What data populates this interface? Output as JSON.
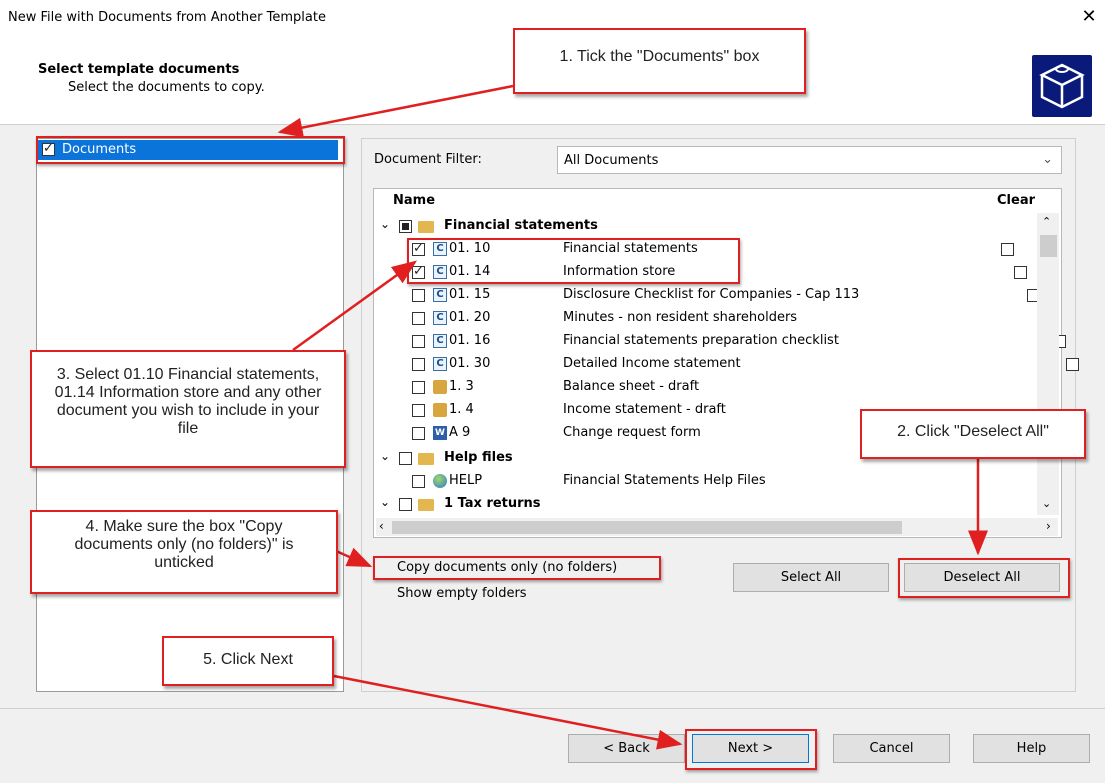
{
  "window": {
    "title": "New File with Documents from Another Template",
    "close_glyph": "✕"
  },
  "header": {
    "heading": "Select template documents",
    "subheading": "Select the documents to copy."
  },
  "left_tree": {
    "root_label": "Documents"
  },
  "filter": {
    "label": "Document Filter:",
    "selected": "All Documents"
  },
  "columns": {
    "name": "Name",
    "clear": "Clear"
  },
  "tree": {
    "group1": "Financial statements",
    "items": [
      {
        "code": "01. 10",
        "desc": "Financial statements",
        "checked": true,
        "icon": "c-doc-icon"
      },
      {
        "code": "01. 14",
        "desc": "Information store",
        "checked": true,
        "icon": "c-doc-icon"
      },
      {
        "code": "01. 15",
        "desc": "Disclosure Checklist for Companies - Cap 113",
        "checked": false,
        "icon": "c-doc-icon"
      },
      {
        "code": "01. 20",
        "desc": "Minutes - non resident shareholders",
        "checked": false,
        "icon": "c-doc-icon"
      },
      {
        "code": "01. 16",
        "desc": "Financial statements preparation checklist",
        "checked": false,
        "icon": "c-doc-icon"
      },
      {
        "code": "01. 30",
        "desc": "Detailed Income statement",
        "checked": false,
        "icon": "c-doc-icon"
      },
      {
        "code": "1. 3",
        "desc": "Balance sheet - draft",
        "checked": false,
        "icon": "spreadsheet-icon"
      },
      {
        "code": "1. 4",
        "desc": "Income statement - draft",
        "checked": false,
        "icon": "spreadsheet-icon"
      },
      {
        "code": "A 9",
        "desc": "Change request form",
        "checked": false,
        "icon": "word-doc-icon"
      }
    ],
    "group2": "Help files",
    "help_item": {
      "code": "HELP",
      "desc": "Financial Statements Help Files",
      "icon": "globe-icon"
    },
    "group3": "1 Tax returns"
  },
  "options": {
    "copy_docs_only": "Copy documents only (no folders)",
    "show_empty": "Show empty folders"
  },
  "buttons": {
    "select_all": "Select All",
    "deselect_all": "Deselect All",
    "back": "< Back",
    "next": "Next >",
    "cancel": "Cancel",
    "help": "Help"
  },
  "annotations": {
    "a1": "1. Tick the \"Documents\" box",
    "a2": "2. Click \"Deselect All\"",
    "a3": "3. Select 01.10 Financial statements, 01.14 Information store and any other document you wish to include in your file",
    "a4": "4. Make sure the box \"Copy documents only (no folders)\" is unticked",
    "a5": "5. Click Next"
  },
  "colors": {
    "selection": "#0a74da",
    "annotation_red": "#e02020",
    "logo_bg": "#0a1a7a"
  }
}
